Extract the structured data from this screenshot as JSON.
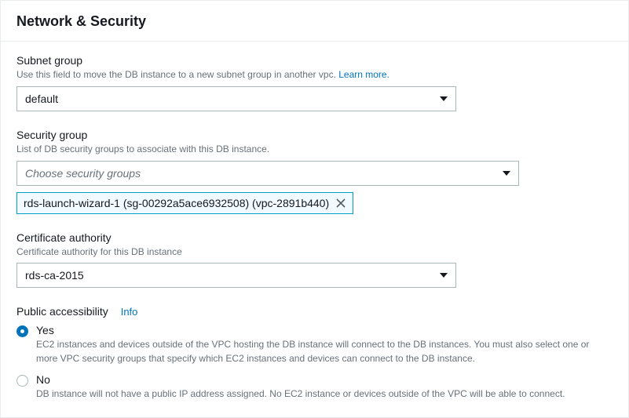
{
  "section": {
    "title": "Network & Security"
  },
  "subnetGroup": {
    "label": "Subnet group",
    "hint": "Use this field to move the DB instance to a new subnet group in another vpc. ",
    "learnMore": "Learn more.",
    "value": "default"
  },
  "securityGroup": {
    "label": "Security group",
    "hint": "List of DB security groups to associate with this DB instance.",
    "placeholder": "Choose security groups",
    "selectedToken": "rds-launch-wizard-1 (sg-00292a5ace6932508) (vpc-2891b440)"
  },
  "certificateAuthority": {
    "label": "Certificate authority",
    "hint": "Certificate authority for this DB instance",
    "value": "rds-ca-2015"
  },
  "publicAccessibility": {
    "label": "Public accessibility",
    "infoLabel": "Info",
    "options": [
      {
        "label": "Yes",
        "description": "EC2 instances and devices outside of the VPC hosting the DB instance will connect to the DB instances. You must also select one or more VPC security groups that specify which EC2 instances and devices can connect to the DB instance.",
        "selected": true
      },
      {
        "label": "No",
        "description": "DB instance will not have a public IP address assigned. No EC2 instance or devices outside of the VPC will be able to connect.",
        "selected": false
      }
    ]
  }
}
